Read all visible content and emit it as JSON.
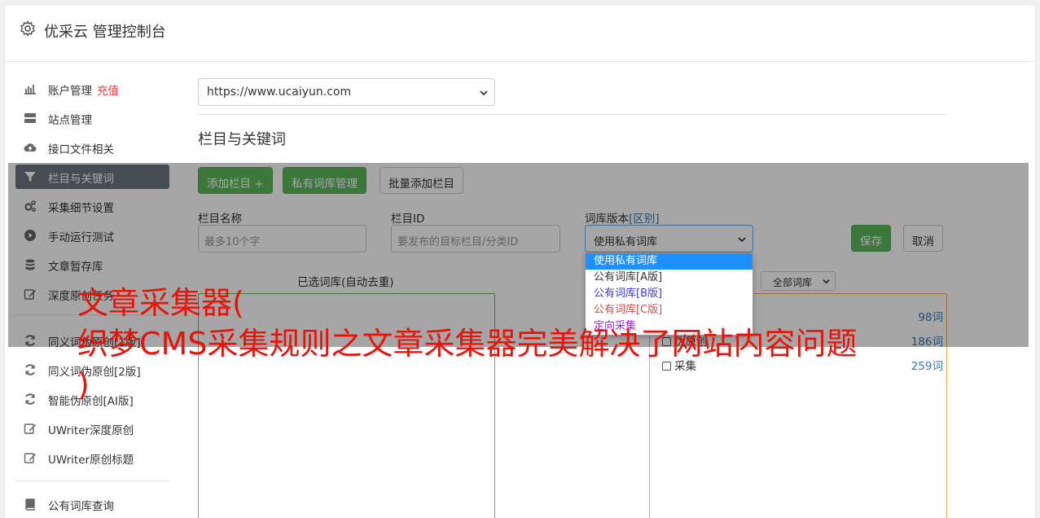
{
  "app": {
    "title": "优采云 管理控制台",
    "icon": "gear-icon"
  },
  "sidebar": {
    "items": [
      {
        "label": "账户管理",
        "badge": "充值",
        "icon": "bar-chart-icon"
      },
      {
        "label": "站点管理",
        "icon": "server-icon"
      },
      {
        "label": "接口文件相关",
        "icon": "cloud-upload-icon"
      },
      {
        "label": "栏目与关键词",
        "icon": "filter-icon",
        "active": true
      },
      {
        "label": "采集细节设置",
        "icon": "cogs-icon"
      },
      {
        "label": "手动运行测试",
        "icon": "play-circle-icon"
      },
      {
        "label": "文章暂存库",
        "icon": "database-icon"
      },
      {
        "label": "深度原创任务",
        "icon": "edit-icon"
      },
      {
        "label": "同义词伪原创[1版]",
        "icon": "refresh-icon"
      },
      {
        "label": "同义词伪原创[2版]",
        "icon": "refresh-icon"
      },
      {
        "label": "智能伪原创[AI版]",
        "icon": "refresh-icon"
      },
      {
        "label": "UWriter深度原创",
        "icon": "edit-icon"
      },
      {
        "label": "UWriter原创标题",
        "icon": "edit-icon"
      },
      {
        "label": "公有词库查询",
        "icon": "book-icon"
      }
    ]
  },
  "site_select": {
    "value": "https://www.ucaiyun.com"
  },
  "section": {
    "title": "栏目与关键词"
  },
  "toolbar": {
    "add_column": "添加栏目 +",
    "private_lib": "私有词库管理",
    "batch_add": "批量添加栏目"
  },
  "form": {
    "name_label": "栏目名称",
    "name_placeholder": "最多10个字",
    "id_label": "栏目ID",
    "id_placeholder": "要发布的目标栏目/分类ID",
    "lib_label": "词库版本",
    "lib_label_link": "[区别]",
    "lib_value": "使用私有词库",
    "save": "保存",
    "cancel": "取消"
  },
  "lib_dropdown": {
    "options": [
      {
        "label": "使用私有词库",
        "color": "#ffffff",
        "selected": true
      },
      {
        "label": "公有词库[A版]",
        "color": "#333333"
      },
      {
        "label": "公有词库[B版]",
        "color": "#3b3bd6"
      },
      {
        "label": "公有词库[C版]",
        "color": "#d14b4b"
      },
      {
        "label": "定向采集",
        "color": "#a020f0"
      }
    ]
  },
  "selected_lib": {
    "label": "已选词库(自动去重)"
  },
  "lib_filter": {
    "value": "全部词库"
  },
  "lib_list": [
    {
      "name": "",
      "count": "98词"
    },
    {
      "name": "伪原创",
      "count": "186词"
    },
    {
      "name": "采集",
      "count": "259词"
    }
  ],
  "headline": {
    "line1": "文章采集器(",
    "line2": "织梦CMS采集规则之文章采集器完美解决了网站内容问题",
    "line3": ")"
  },
  "colors": {
    "accent_green": "#5cb85c",
    "active_gray": "#6c757d",
    "headline_red": "#e8140a",
    "link_blue": "#337ab7"
  }
}
